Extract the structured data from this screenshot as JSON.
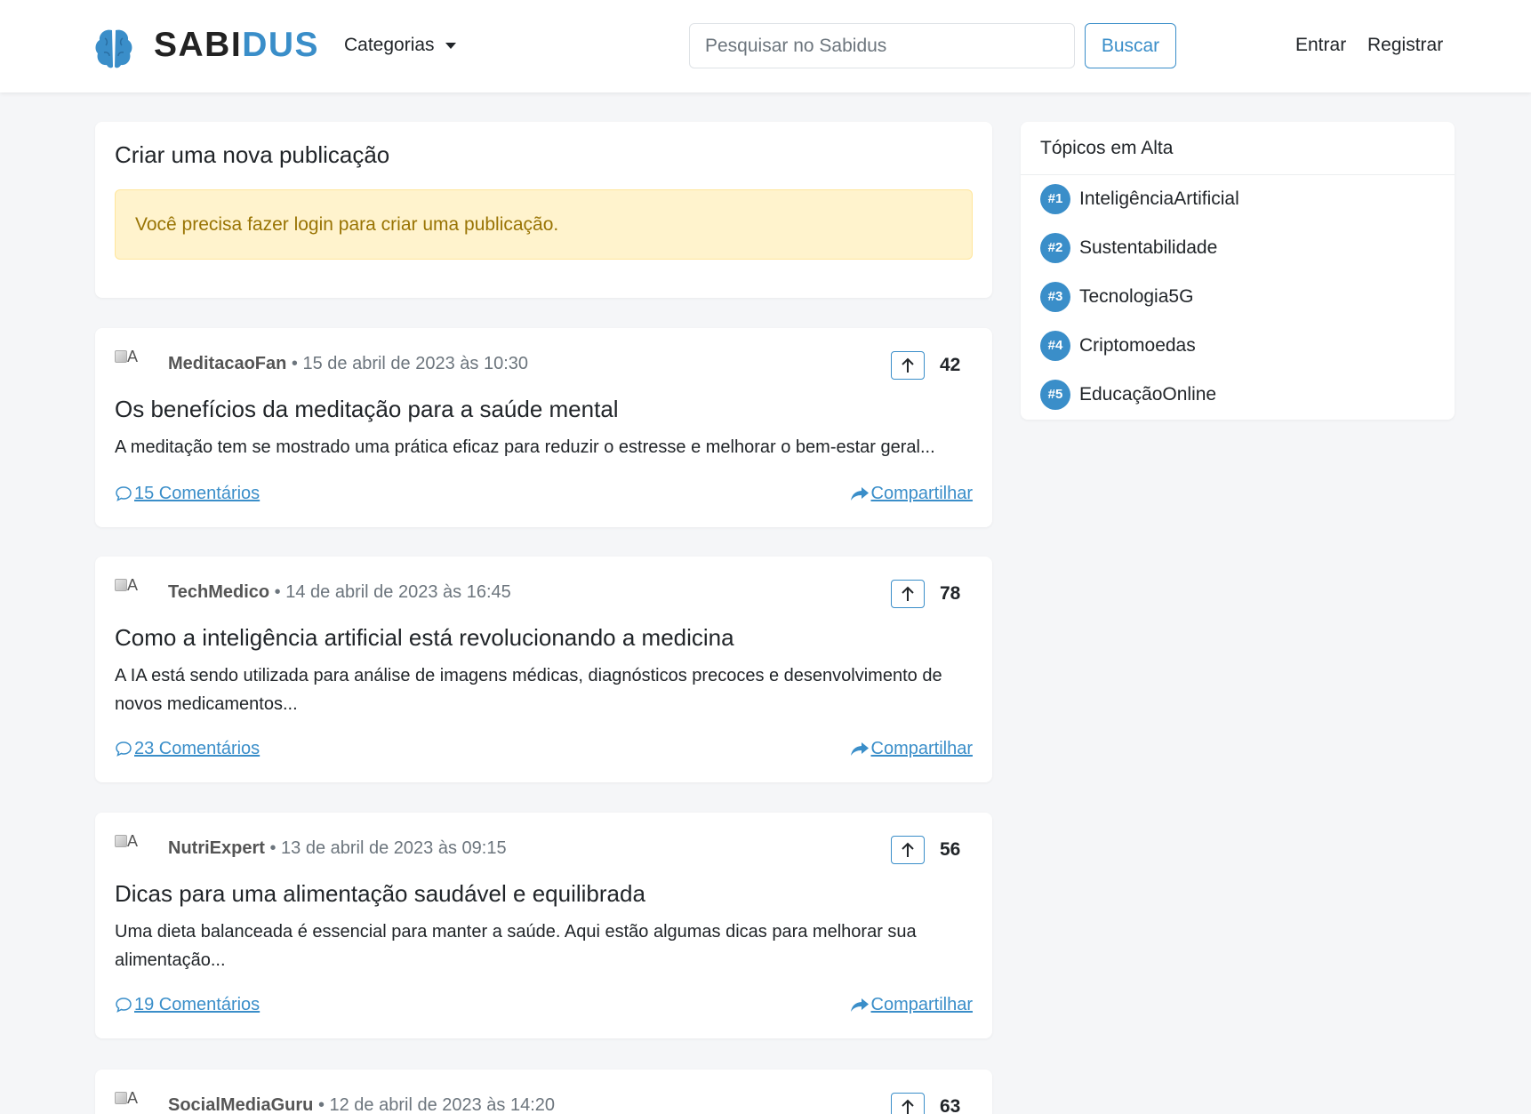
{
  "brand": {
    "part1": "SABI",
    "part2": "DUS",
    "accent": "#3a8ec9"
  },
  "nav": {
    "categories_label": "Categorias",
    "search_placeholder": "Pesquisar no Sabidus",
    "search_button": "Buscar",
    "login": "Entrar",
    "register": "Registrar"
  },
  "create": {
    "title": "Criar uma nova publicação",
    "alert": "Você precisa fazer login para criar uma publicação."
  },
  "posts": [
    {
      "avatar_alt": "A",
      "author": "MeditacaoFan",
      "date": "• 15 de abril de 2023 às 10:30",
      "votes": "42",
      "title": "Os benefícios da meditação para a saúde mental",
      "excerpt": "A meditação tem se mostrado uma prática eficaz para reduzir o estresse e melhorar o bem-estar geral...",
      "comments": "15 Comentários",
      "share": "Compartilhar"
    },
    {
      "avatar_alt": "A",
      "author": "TechMedico",
      "date": "• 14 de abril de 2023 às 16:45",
      "votes": "78",
      "title": "Como a inteligência artificial está revolucionando a medicina",
      "excerpt": "A IA está sendo utilizada para análise de imagens médicas, diagnósticos precoces e desenvolvimento de novos medicamentos...",
      "comments": "23 Comentários",
      "share": "Compartilhar"
    },
    {
      "avatar_alt": "A",
      "author": "NutriExpert",
      "date": "• 13 de abril de 2023 às 09:15",
      "votes": "56",
      "title": "Dicas para uma alimentação saudável e equilibrada",
      "excerpt": "Uma dieta balanceada é essencial para manter a saúde. Aqui estão algumas dicas para melhorar sua alimentação...",
      "comments": "19 Comentários",
      "share": "Compartilhar"
    },
    {
      "avatar_alt": "A",
      "author": "SocialMediaGuru",
      "date": "• 12 de abril de 2023 às 14:20",
      "votes": "63"
    }
  ],
  "trending": {
    "title": "Tópicos em Alta",
    "items": [
      {
        "rank": "#1",
        "label": "InteligênciaArtificial"
      },
      {
        "rank": "#2",
        "label": "Sustentabilidade"
      },
      {
        "rank": "#3",
        "label": "Tecnologia5G"
      },
      {
        "rank": "#4",
        "label": "Criptomoedas"
      },
      {
        "rank": "#5",
        "label": "EducaçãoOnline"
      }
    ]
  }
}
